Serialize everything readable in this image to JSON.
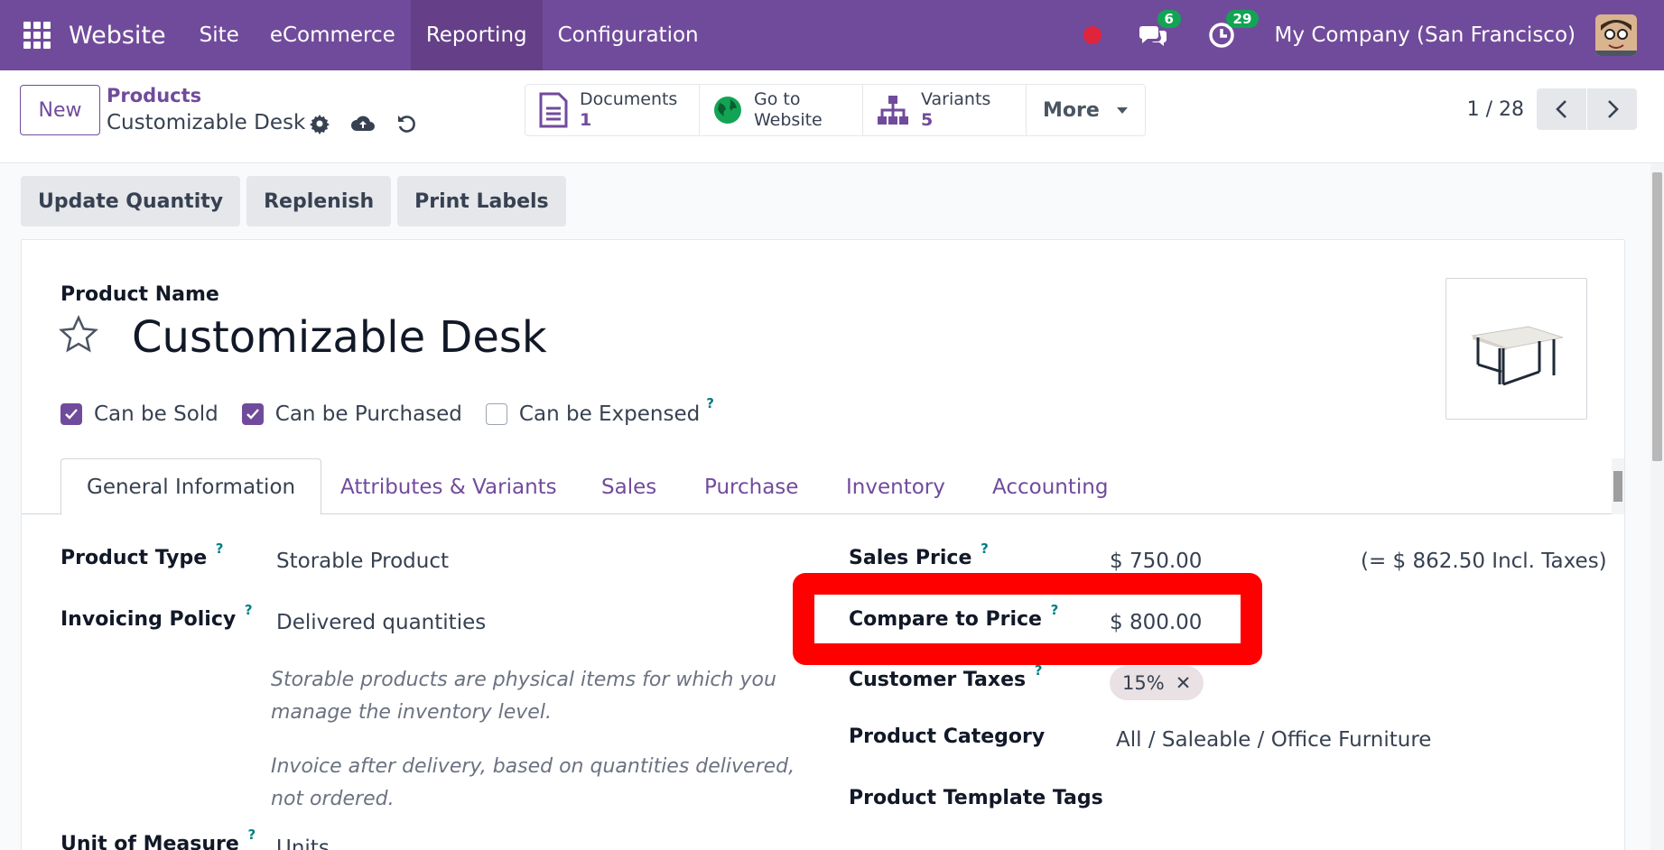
{
  "navbar": {
    "brand": "Website",
    "menu": [
      "Site",
      "eCommerce",
      "Reporting",
      "Configuration"
    ],
    "messages_count": "6",
    "activities_count": "29",
    "company": "My Company (San Francisco)"
  },
  "control": {
    "new_label": "New",
    "breadcrumb_parent": "Products",
    "breadcrumb_current": "Customizable Desk",
    "smart_buttons": {
      "documents_label": "Documents",
      "documents_value": "1",
      "website_label": "Go to",
      "website_label2": "Website",
      "variants_label": "Variants",
      "variants_value": "5",
      "more_label": "More"
    },
    "pager": "1 / 28"
  },
  "actions": [
    "Update Quantity",
    "Replenish",
    "Print Labels"
  ],
  "form": {
    "name_label": "Product Name",
    "name": "Customizable Desk",
    "checks": {
      "can_be_sold": "Can be Sold",
      "can_be_purchased": "Can be Purchased",
      "can_be_expensed": "Can be Expensed"
    },
    "tabs": [
      "General Information",
      "Attributes & Variants",
      "Sales",
      "Purchase",
      "Inventory",
      "Accounting"
    ],
    "left": {
      "product_type_label": "Product Type",
      "product_type": "Storable Product",
      "invoicing_policy_label": "Invoicing Policy",
      "invoicing_policy": "Delivered quantities",
      "note1_line1": "Storable products are physical items for which you",
      "note1_line2": "manage the inventory level.",
      "note2_line1": "Invoice after delivery, based on quantities delivered,",
      "note2_line2": "not ordered.",
      "uom_label": "Unit of Measure",
      "uom": "Units"
    },
    "right": {
      "sales_price_label": "Sales Price",
      "sales_price": "$ 750.00",
      "incl_taxes": "(= $ 862.50 Incl. Taxes)",
      "compare_price_label": "Compare to Price",
      "compare_price": "$ 800.00",
      "customer_taxes_label": "Customer Taxes",
      "customer_tax": "15%",
      "category_label": "Product Category",
      "category": "All / Saleable / Office Furniture",
      "tags_label": "Product Template Tags"
    }
  },
  "colors": {
    "brand": "#714b9b",
    "highlight": "#ff0000",
    "badge": "#12a454"
  }
}
